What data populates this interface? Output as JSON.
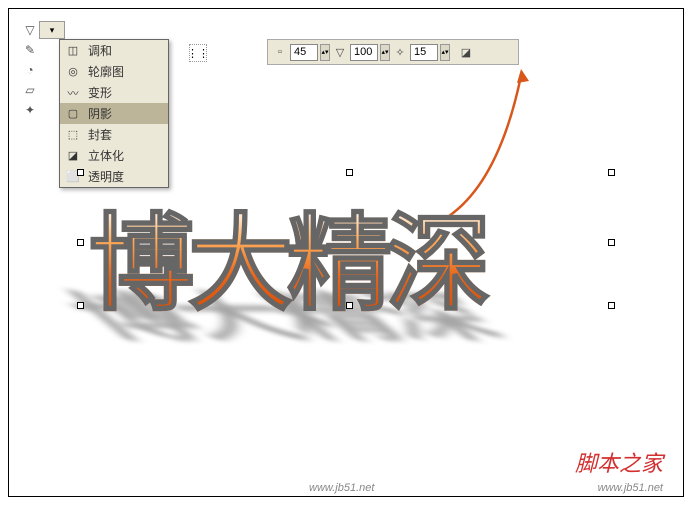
{
  "toolbox": {
    "tools": [
      "▽",
      "✎",
      "◔",
      "▱",
      "✦"
    ]
  },
  "menu": {
    "items": [
      {
        "icon": "◫",
        "label": "调和"
      },
      {
        "icon": "◎",
        "label": "轮廓图"
      },
      {
        "icon": "〰",
        "label": "变形"
      },
      {
        "icon": "▢",
        "label": "阴影",
        "selected": true
      },
      {
        "icon": "⬚",
        "label": "封套"
      },
      {
        "icon": "◪",
        "label": "立体化"
      },
      {
        "icon": "⬜",
        "label": "透明度"
      }
    ]
  },
  "topbar": {
    "field1": {
      "value": "45"
    },
    "field2": {
      "value": "100"
    },
    "field3": {
      "value": "15"
    }
  },
  "canvas": {
    "text": "博大精深"
  },
  "watermark": {
    "url1": "www.jb51.net",
    "brand": "脚本之家",
    "url2": "www.jb51.net"
  }
}
